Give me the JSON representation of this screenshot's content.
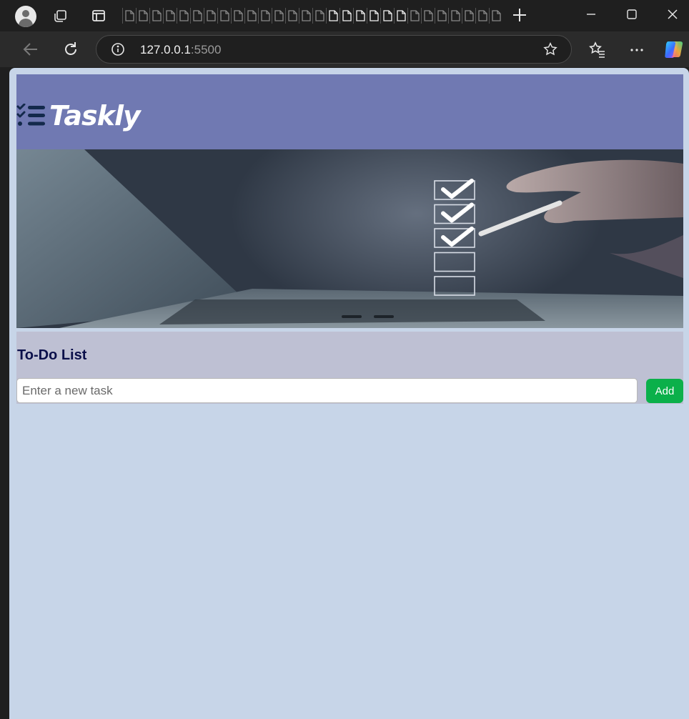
{
  "browser": {
    "url_host": "127.0.0.1",
    "url_port": ":5500",
    "tab_count": 28,
    "icons": {
      "profile": "profile-icon",
      "workspaces": "workspaces-icon",
      "tab_actions": "tab-actions-icon",
      "new_tab": "plus-icon",
      "minimize": "minimize-icon",
      "maximize": "maximize-icon",
      "close": "close-icon",
      "back": "back-arrow-icon",
      "reload": "reload-icon",
      "site_info": "info-icon",
      "favorite": "star-icon",
      "favorites": "favorites-icon",
      "more": "more-icon",
      "copilot": "copilot-icon"
    }
  },
  "app": {
    "brand": "Taskly",
    "logo_icon": "checklist-icon",
    "colors": {
      "header_bg": "#7079b2",
      "page_bg": "#c7d5e8",
      "section_bg": "#bec0d3",
      "title_color": "#0a0f4a",
      "add_button": "#0bb04a"
    },
    "hero": {
      "image": "laptop-checklist-photo",
      "checkboxes": [
        true,
        true,
        true,
        false,
        false
      ]
    },
    "todo": {
      "title": "To-Do List",
      "input_value": "",
      "input_placeholder": "Enter a new task",
      "add_label": "Add"
    }
  }
}
